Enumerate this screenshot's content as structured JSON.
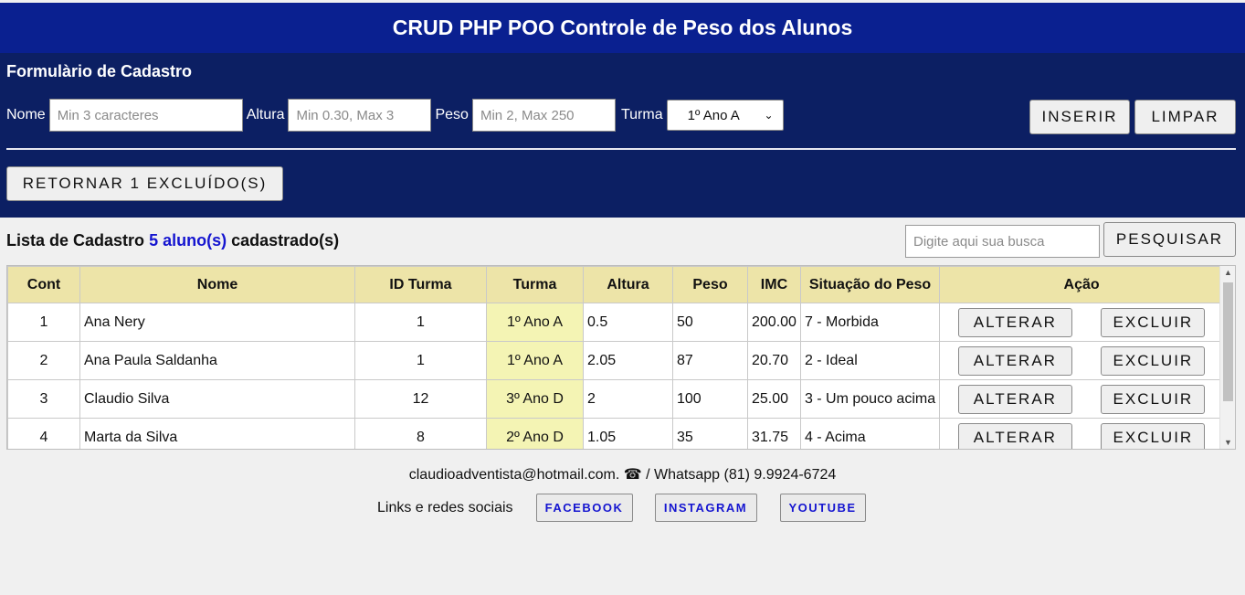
{
  "header": {
    "title": "CRUD PHP POO Controle de Peso dos Alunos"
  },
  "form": {
    "title": "Formulàrio de Cadastro",
    "nome_label": "Nome",
    "nome_placeholder": "Min 3 caracteres",
    "altura_label": "Altura",
    "altura_placeholder": "Min 0.30, Max 3",
    "peso_label": "Peso",
    "peso_placeholder": "Min 2, Max 250",
    "turma_label": "Turma",
    "turma_selected": "1º Ano A",
    "inserir_label": "INSERIR",
    "limpar_label": "LIMPAR",
    "retornar_label": "RETORNAR 1 EXCLUÍDO(S)"
  },
  "list": {
    "title_prefix": "Lista de Cadastro",
    "count_text": "5 aluno(s)",
    "title_suffix": "cadastrado(s)",
    "search_placeholder": "Digite aqui sua busca",
    "search_button": "PESQUISAR"
  },
  "table": {
    "headers": [
      "Cont",
      "Nome",
      "ID Turma",
      "Turma",
      "Altura",
      "Peso",
      "IMC",
      "Situação do Peso",
      "Ação"
    ],
    "alterar_label": "ALTERAR",
    "excluir_label": "EXCLUIR",
    "rows": [
      {
        "cont": "1",
        "nome": "Ana Nery",
        "id_turma": "1",
        "turma": "1º Ano A",
        "altura": "0.5",
        "peso": "50",
        "imc": "200.00",
        "situacao": "7 - Morbida"
      },
      {
        "cont": "2",
        "nome": "Ana Paula Saldanha",
        "id_turma": "1",
        "turma": "1º Ano A",
        "altura": "2.05",
        "peso": "87",
        "imc": "20.70",
        "situacao": "2 - Ideal"
      },
      {
        "cont": "3",
        "nome": "Claudio Silva",
        "id_turma": "12",
        "turma": "3º Ano D",
        "altura": "2",
        "peso": "100",
        "imc": "25.00",
        "situacao": "3 - Um pouco acima"
      },
      {
        "cont": "4",
        "nome": "Marta da Silva",
        "id_turma": "8",
        "turma": "2º Ano D",
        "altura": "1.05",
        "peso": "35",
        "imc": "31.75",
        "situacao": "4 - Acima"
      }
    ]
  },
  "footer": {
    "contact": "claudioadventista@hotmail.com. ☎ / Whatsapp (81) 9.9924-6724",
    "social_label": "Links e redes sociais",
    "facebook": "FACEBOOK",
    "instagram": "INSTAGRAM",
    "youtube": "YOUTUBE"
  },
  "colors": {
    "header_bg": "#0a2090",
    "form_bg": "#0c1f63",
    "table_header_bg": "#ede4a8",
    "turma_cell_bg": "#f4f4b4",
    "accent_blue": "#1515d0"
  },
  "icons": {
    "select_arrow": "chevron-down-icon",
    "phone": "phone-icon"
  }
}
